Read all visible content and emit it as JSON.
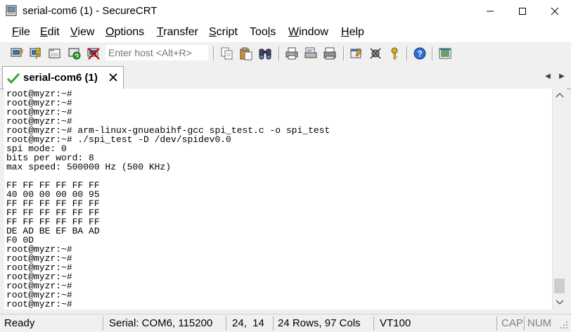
{
  "window": {
    "title": "serial-com6 (1) - SecureCRT"
  },
  "menu": [
    {
      "label": "File",
      "u": "F",
      "rest": "ile"
    },
    {
      "label": "Edit",
      "u": "E",
      "rest": "dit"
    },
    {
      "label": "View",
      "u": "V",
      "rest": "iew"
    },
    {
      "label": "Options",
      "u": "O",
      "rest": "ptions"
    },
    {
      "label": "Transfer",
      "u": "T",
      "rest": "ransfer"
    },
    {
      "label": "Script",
      "u": "S",
      "rest": "cript"
    },
    {
      "label": "Tools",
      "pre": "Too",
      "u": "l",
      "rest": "s"
    },
    {
      "label": "Window",
      "u": "W",
      "rest": "indow"
    },
    {
      "label": "Help",
      "u": "H",
      "rest": "elp"
    }
  ],
  "toolbar": {
    "host_placeholder": "Enter host <Alt+R>",
    "icons": [
      "connect-icon",
      "quick-connect-icon",
      "connect-in-tab-icon",
      "reconnect-icon",
      "disconnect-icon",
      "copy-icon",
      "paste-icon",
      "find-icon",
      "print-icon",
      "print-selection-icon",
      "print-screen-icon",
      "session-options-icon",
      "global-options-icon",
      "keymap-icon",
      "help-icon",
      "sftp-icon"
    ]
  },
  "tab": {
    "label": "serial-com6 (1)"
  },
  "terminal": {
    "lines": [
      "root@myzr:~#",
      "root@myzr:~#",
      "root@myzr:~#",
      "root@myzr:~#",
      "root@myzr:~# arm-linux-gnueabihf-gcc spi_test.c -o spi_test",
      "root@myzr:~# ./spi_test -D /dev/spidev0.0",
      "spi mode: 0",
      "bits per word: 8",
      "max speed: 500000 Hz (500 KHz)",
      "",
      "FF FF FF FF FF FF",
      "40 00 00 00 00 95",
      "FF FF FF FF FF FF",
      "FF FF FF FF FF FF",
      "FF FF FF FF FF FF",
      "DE AD BE EF BA AD",
      "F0 0D",
      "root@myzr:~#",
      "root@myzr:~#",
      "root@myzr:~#",
      "root@myzr:~#",
      "root@myzr:~#",
      "root@myzr:~#",
      "root@myzr:~#"
    ]
  },
  "status": {
    "ready": "Ready",
    "connection": "Serial: COM6, 115200",
    "cursor": "24,  14",
    "size": "24 Rows, 97 Cols",
    "emulation": "VT100",
    "cap": "CAP",
    "num": "NUM"
  },
  "colors": {
    "accent_check": "#3aa03a",
    "close_red": "#c00000"
  }
}
